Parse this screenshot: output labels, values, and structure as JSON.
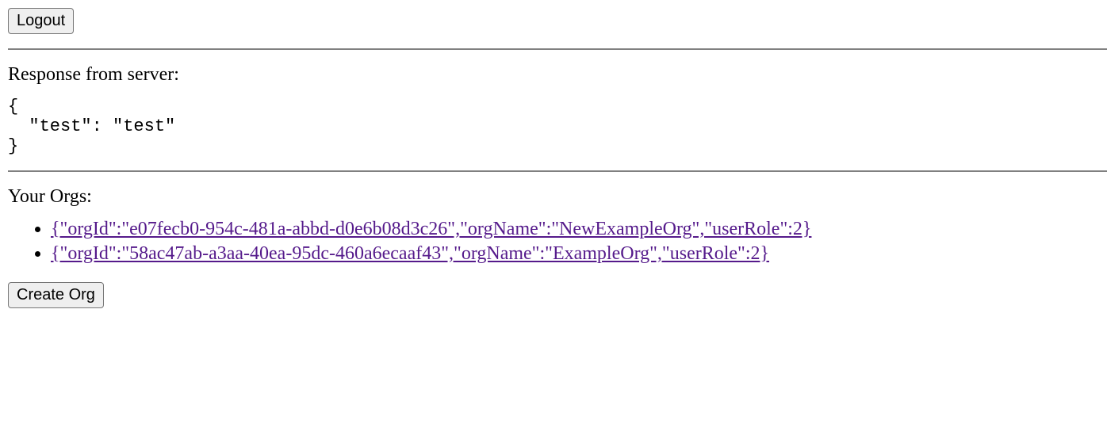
{
  "buttons": {
    "logout_label": "Logout",
    "create_org_label": "Create Org"
  },
  "response": {
    "label": "Response from server:",
    "body": "{\n  \"test\": \"test\"\n}"
  },
  "orgs": {
    "label": "Your Orgs:",
    "items": [
      {
        "text": "{\"orgId\":\"e07fecb0-954c-481a-abbd-d0e6b08d3c26\",\"orgName\":\"NewExampleOrg\",\"userRole\":2}"
      },
      {
        "text": "{\"orgId\":\"58ac47ab-a3aa-40ea-95dc-460a6ecaaf43\",\"orgName\":\"ExampleOrg\",\"userRole\":2}"
      }
    ]
  }
}
